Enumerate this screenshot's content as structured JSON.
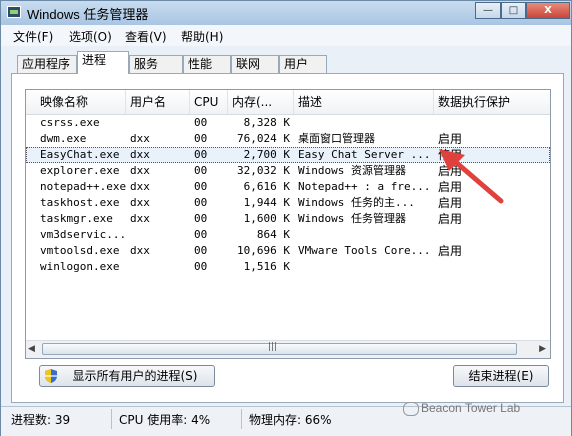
{
  "window": {
    "title": "Windows 任务管理器",
    "min": "—",
    "max": "□",
    "close": "X"
  },
  "menu": [
    "文件(F)",
    "选项(O)",
    "查看(V)",
    "帮助(H)"
  ],
  "tabs": [
    "应用程序",
    "进程",
    "服务",
    "性能",
    "联网",
    "用户"
  ],
  "active_tab": "进程",
  "columns": [
    "映像名称",
    "用户名",
    "CPU",
    "内存(...",
    "描述",
    "数据执行保护"
  ],
  "processes": [
    {
      "name": "csrss.exe",
      "user": "",
      "cpu": "00",
      "mem": "8,328 K",
      "desc": "",
      "dep": ""
    },
    {
      "name": "dwm.exe",
      "user": "dxx",
      "cpu": "00",
      "mem": "76,024 K",
      "desc": "桌面窗口管理器",
      "dep": "启用"
    },
    {
      "name": "EasyChat.exe",
      "user": "dxx",
      "cpu": "00",
      "mem": "2,700 K",
      "desc": "Easy Chat Server ...",
      "dep": "停用"
    },
    {
      "name": "explorer.exe",
      "user": "dxx",
      "cpu": "00",
      "mem": "32,032 K",
      "desc": "Windows 资源管理器",
      "dep": "启用"
    },
    {
      "name": "notepad++.exe",
      "user": "dxx",
      "cpu": "00",
      "mem": "6,616 K",
      "desc": "Notepad++ : a fre...",
      "dep": "启用"
    },
    {
      "name": "taskhost.exe",
      "user": "dxx",
      "cpu": "00",
      "mem": "1,944 K",
      "desc": "Windows 任务的主...",
      "dep": "启用"
    },
    {
      "name": "taskmgr.exe",
      "user": "dxx",
      "cpu": "00",
      "mem": "1,600 K",
      "desc": "Windows 任务管理器",
      "dep": "启用"
    },
    {
      "name": "vm3dservic...",
      "user": "",
      "cpu": "00",
      "mem": "864 K",
      "desc": "",
      "dep": ""
    },
    {
      "name": "vmtoolsd.exe",
      "user": "dxx",
      "cpu": "00",
      "mem": "10,696 K",
      "desc": "VMware Tools Core...",
      "dep": "启用"
    },
    {
      "name": "winlogon.exe",
      "user": "",
      "cpu": "00",
      "mem": "1,516 K",
      "desc": "",
      "dep": ""
    }
  ],
  "selected_row": 2,
  "buttons": {
    "show_all": "显示所有用户的进程(S)",
    "end_process": "结束进程(E)"
  },
  "status": {
    "processes": "进程数: 39",
    "cpu": "CPU 使用率: 4%",
    "memory": "物理内存: 66%"
  },
  "watermark": "Beacon Tower Lab",
  "annotation_color": "#e0413c"
}
